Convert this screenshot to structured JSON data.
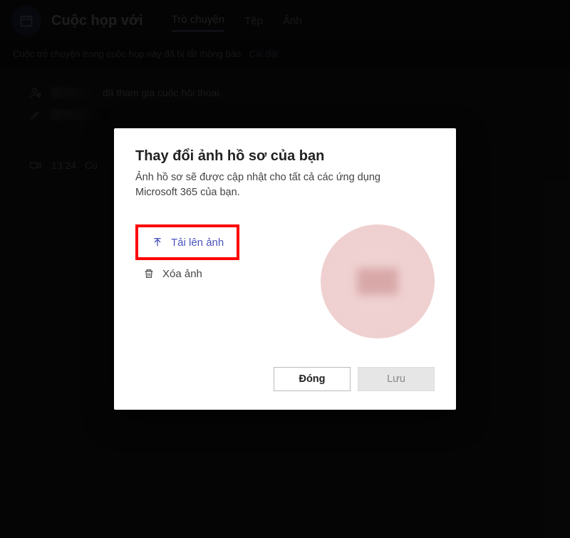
{
  "header": {
    "title": "Cuộc họp với",
    "tabs": {
      "chat": "Trò chuyện",
      "file": "Tệp",
      "image": "Ảnh"
    }
  },
  "banner": {
    "text": "Cuộc trò chuyện trong cuộc họp này đã bị tắt thông báo.",
    "link": "Cài đặt"
  },
  "feed": {
    "joined_suffix": "đã tham gia cuộc hội thoại.",
    "meeting_time": "13:24",
    "meeting_prefix": "Cu"
  },
  "modal": {
    "title": "Thay đổi ảnh hồ sơ của bạn",
    "subtitle": "Ảnh hồ sơ sẽ được cập nhật cho tất cả các ứng dụng Microsoft 365 của bạn.",
    "upload_label": "Tải lên ảnh",
    "delete_label": "Xóa ảnh",
    "close_label": "Đóng",
    "save_label": "Lưu"
  }
}
